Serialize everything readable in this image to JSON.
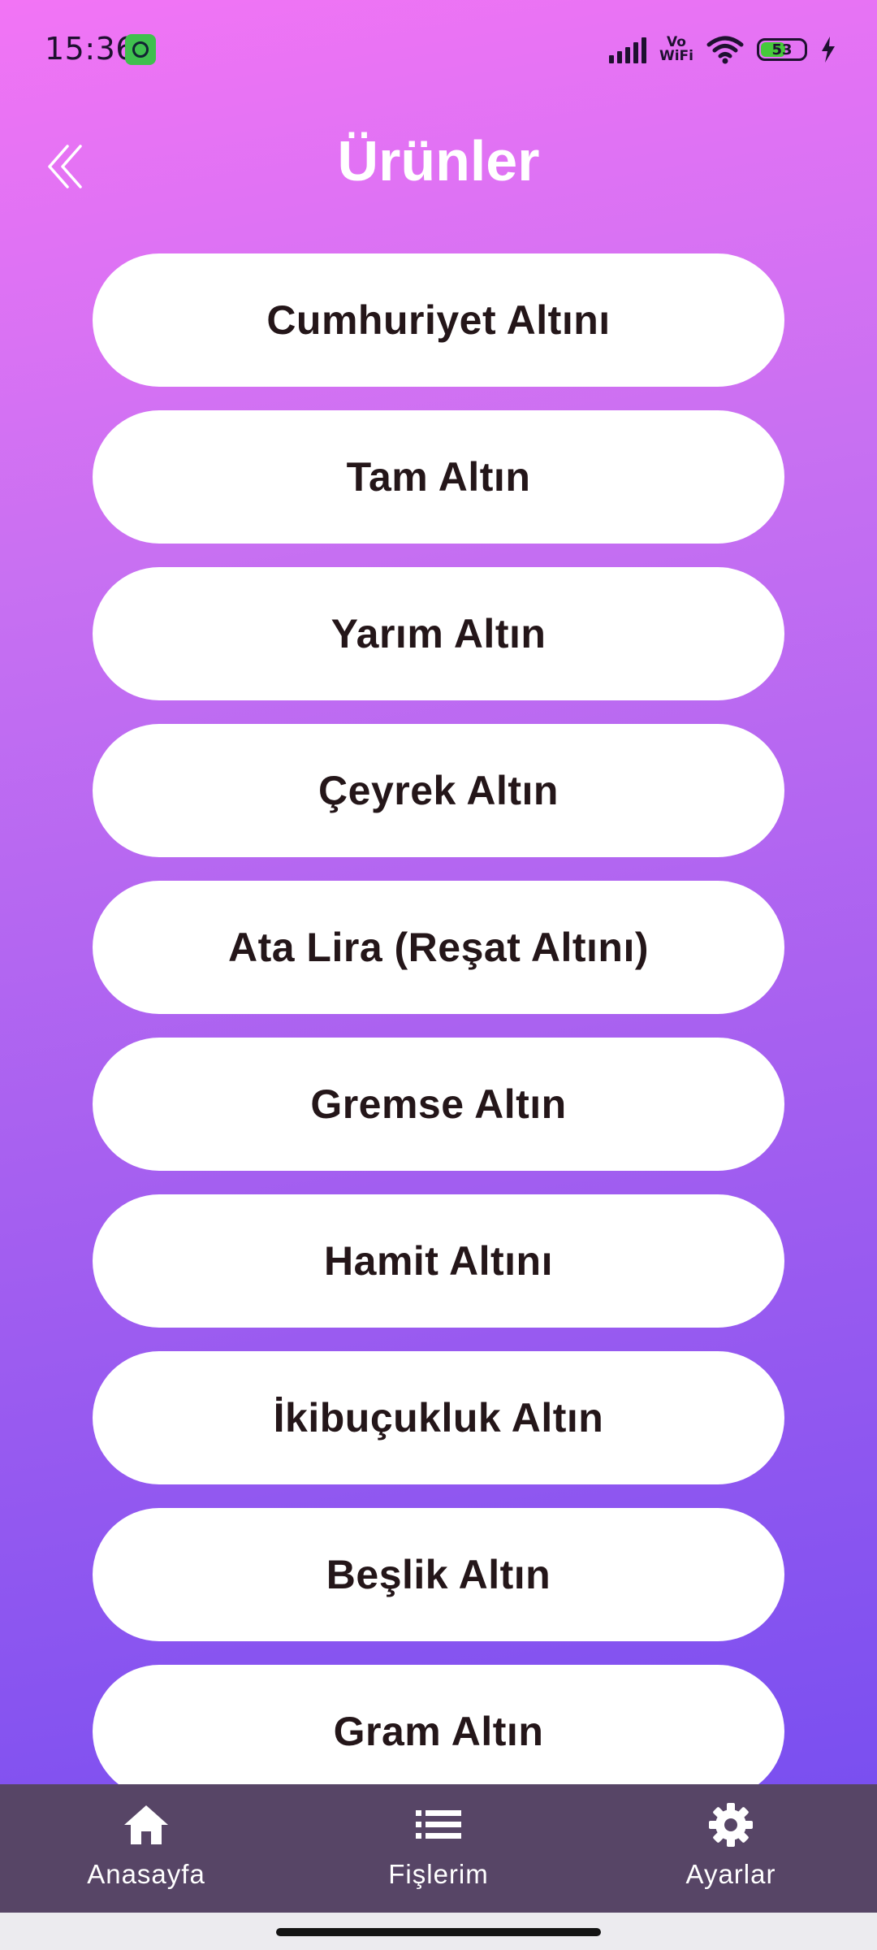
{
  "status_bar": {
    "time": "15:36",
    "network_label": "Vo WiFi",
    "battery_level": "53",
    "battery_fraction": 0.53,
    "icons": [
      "cat-notification-icon",
      "signal-icon",
      "vowifi-icon",
      "wifi-icon",
      "battery-icon",
      "charging-icon"
    ]
  },
  "header": {
    "title": "Ürünler",
    "back_icon": "double-chevron-left-icon"
  },
  "products": [
    {
      "label": "Cumhuriyet Altını"
    },
    {
      "label": "Tam Altın"
    },
    {
      "label": "Yarım Altın"
    },
    {
      "label": "Çeyrek Altın"
    },
    {
      "label": "Ata Lira (Reşat Altını)"
    },
    {
      "label": "Gremse Altın"
    },
    {
      "label": "Hamit Altını"
    },
    {
      "label": "İkibuçukluk Altın"
    },
    {
      "label": "Beşlik Altın"
    },
    {
      "label": "Gram Altın"
    }
  ],
  "bottom_nav": {
    "items": [
      {
        "label": "Anasayfa",
        "icon": "home-icon"
      },
      {
        "label": "Fişlerim",
        "icon": "list-icon"
      },
      {
        "label": "Ayarlar",
        "icon": "gear-icon"
      }
    ]
  },
  "colors": {
    "gradient_top": "#f274f5",
    "gradient_bottom": "#7a4ff0",
    "nav_background": "#574566",
    "button_background": "#ffffff",
    "button_text": "#241619"
  }
}
